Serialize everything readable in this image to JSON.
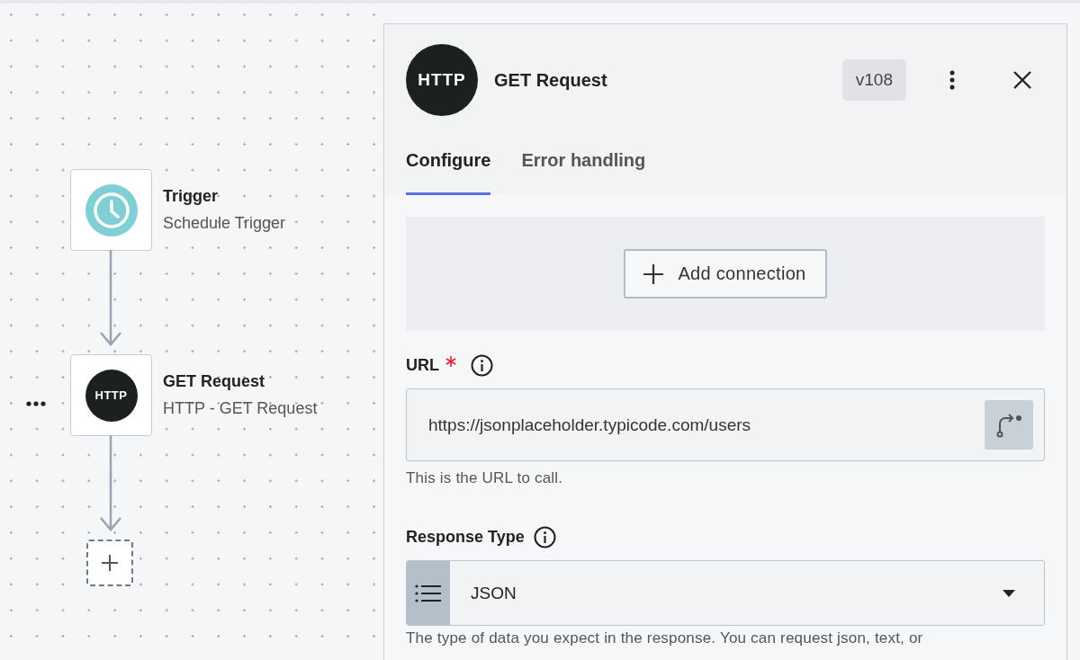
{
  "canvas": {
    "nodes": [
      {
        "kind": "schedule",
        "title": "Trigger",
        "subtitle": "Schedule Trigger",
        "has_menu": false
      },
      {
        "kind": "http",
        "icon_text": "HTTP",
        "title": "GET Request",
        "subtitle": "HTTP - GET Request",
        "has_menu": true
      }
    ],
    "add_step": true
  },
  "panel": {
    "icon_text": "HTTP",
    "title": "GET Request",
    "version": "v108",
    "tabs": [
      {
        "label": "Configure",
        "selected": true
      },
      {
        "label": "Error handling",
        "selected": false
      }
    ],
    "connection_button": "Add connection",
    "fields": [
      {
        "kind": "text",
        "label": "URL",
        "required": true,
        "value": "https://jsonplaceholder.typicode.com/users",
        "hint": "This is the URL to call."
      },
      {
        "kind": "select",
        "label": "Response Type",
        "required": false,
        "value": "JSON",
        "hint": "The type of data you expect in the response. You can request json, text, or"
      }
    ]
  }
}
